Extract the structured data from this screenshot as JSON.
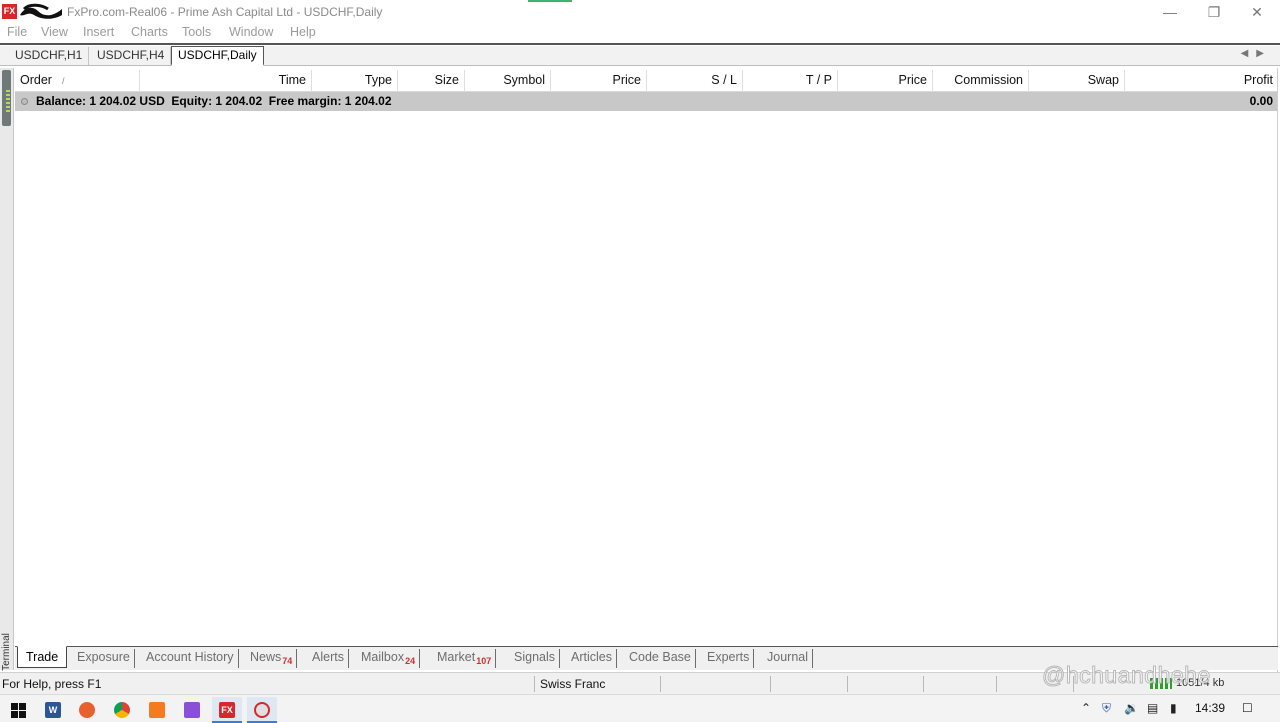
{
  "window": {
    "title": "FxPro.com-Real06 - Prime Ash Capital Ltd - USDCHF,Daily",
    "app_icon": "fxpro-logo-icon",
    "controls": [
      "minimize-icon",
      "restore-icon",
      "close-icon"
    ]
  },
  "menu": {
    "items": [
      "File",
      "View",
      "Insert",
      "Charts",
      "Tools",
      "Window",
      "Help"
    ]
  },
  "chart_tabs": {
    "tabs": [
      "USDCHF,H1",
      "USDCHF,H4",
      "USDCHF,Daily"
    ],
    "active": "USDCHF,Daily"
  },
  "terminal": {
    "label": "Terminal",
    "columns": [
      "Order",
      "Time",
      "Type",
      "Size",
      "Symbol",
      "Price",
      "S / L",
      "T / P",
      "Price",
      "Commission",
      "Swap",
      "Profit"
    ],
    "sort_marker": "/",
    "balance_row": {
      "text": "Balance: 1 204.02 USD  Equity: 1 204.02  Free margin: 1 204.02",
      "profit": "0.00"
    },
    "tabs": [
      {
        "label": "Trade",
        "badge": ""
      },
      {
        "label": "Exposure",
        "badge": ""
      },
      {
        "label": "Account History",
        "badge": ""
      },
      {
        "label": "News",
        "badge": "74"
      },
      {
        "label": "Alerts",
        "badge": ""
      },
      {
        "label": "Mailbox",
        "badge": "24"
      },
      {
        "label": "Market",
        "badge": "107"
      },
      {
        "label": "Signals",
        "badge": ""
      },
      {
        "label": "Articles",
        "badge": ""
      },
      {
        "label": "Code Base",
        "badge": ""
      },
      {
        "label": "Experts",
        "badge": ""
      },
      {
        "label": "Journal",
        "badge": ""
      }
    ],
    "active_tab": "Trade"
  },
  "status": {
    "help": "For Help, press F1",
    "symbol_name": "Swiss Franc",
    "connection": "1051/4 kb"
  },
  "watermark": "@hchuandhehe",
  "taskbar": {
    "time": "14:39",
    "apps": [
      "windows-start-icon",
      "word-icon",
      "firefox-icon",
      "chrome-icon",
      "app-orange-icon",
      "app-purple-icon",
      "fxpro-icon",
      "active-app-icon"
    ]
  },
  "colors": {
    "balance_row_bg": "#c8c8c8",
    "badge": "#d0302d",
    "fxpro_red": "#d8262b"
  }
}
